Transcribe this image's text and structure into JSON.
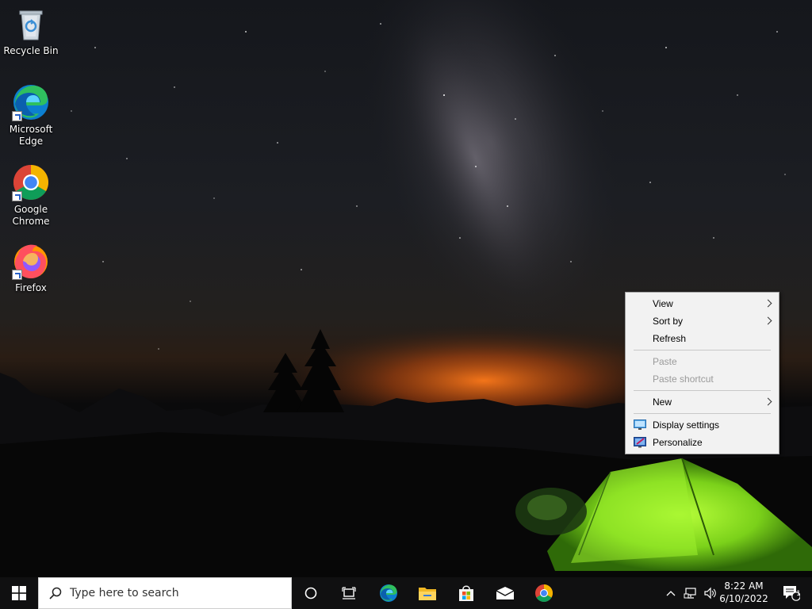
{
  "desktop": {
    "icons": [
      {
        "label": "Recycle Bin",
        "icon": "recycle-bin-icon"
      },
      {
        "label": "Microsoft Edge",
        "icon": "edge-icon"
      },
      {
        "label": "Google Chrome",
        "icon": "chrome-icon"
      },
      {
        "label": "Firefox",
        "icon": "firefox-icon"
      }
    ]
  },
  "context_menu": {
    "items": [
      {
        "label": "View",
        "submenu": true,
        "enabled": true
      },
      {
        "label": "Sort by",
        "submenu": true,
        "enabled": true
      },
      {
        "label": "Refresh",
        "submenu": false,
        "enabled": true
      },
      {
        "label": "Paste",
        "submenu": false,
        "enabled": false
      },
      {
        "label": "Paste shortcut",
        "submenu": false,
        "enabled": false
      },
      {
        "label": "New",
        "submenu": true,
        "enabled": true
      },
      {
        "label": "Display settings",
        "submenu": false,
        "enabled": true,
        "icon": "display-settings-icon"
      },
      {
        "label": "Personalize",
        "submenu": false,
        "enabled": true,
        "icon": "personalize-icon"
      }
    ]
  },
  "taskbar": {
    "search_placeholder": "Type here to search",
    "pinned": [
      "cortana-icon",
      "task-view-icon",
      "edge-icon",
      "file-explorer-icon",
      "store-icon",
      "mail-icon",
      "chrome-icon"
    ],
    "clock": {
      "time": "8:22 AM",
      "date": "6/10/2022"
    },
    "notification_count": "1"
  },
  "colors": {
    "taskbar_bg": "#101011",
    "menu_bg": "#f2f2f2",
    "edge_blue": "#0c7fd0",
    "edge_green": "#2fbf5f",
    "chrome_red": "#db4437",
    "chrome_yellow": "#f4b400",
    "chrome_green": "#0f9d58",
    "chrome_blue": "#4285f4",
    "tent_green": "#8fe022"
  }
}
